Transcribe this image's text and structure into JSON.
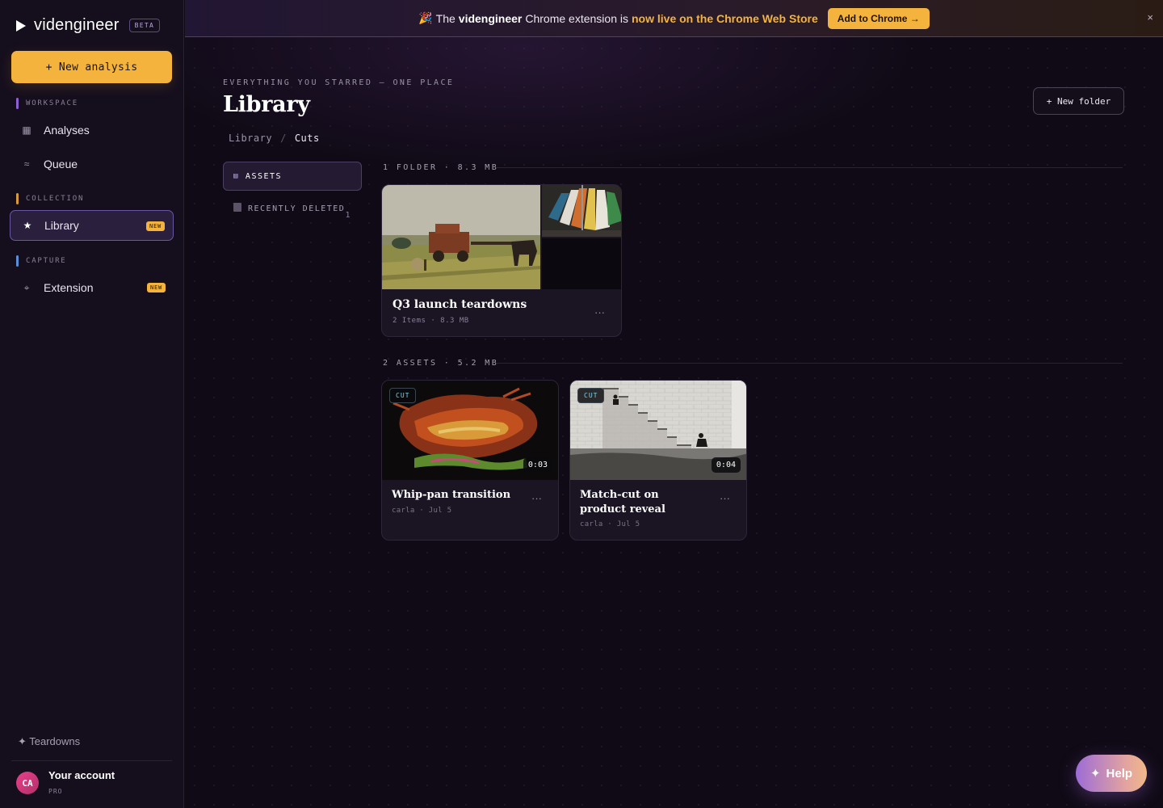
{
  "brand": {
    "name": "videngineer",
    "badge": "BETA"
  },
  "sidebar": {
    "new_analysis": "+ New analysis",
    "sections": {
      "workspace": "WORKSPACE",
      "collection": "COLLECTION",
      "capture": "CAPTURE"
    },
    "items": {
      "analyses": {
        "label": "Analyses",
        "icon": "grid-icon"
      },
      "queue": {
        "label": "Queue",
        "icon": "waves-icon"
      },
      "library": {
        "label": "Library",
        "icon": "star-icon",
        "badge": "NEW"
      },
      "extension": {
        "label": "Extension",
        "icon": "crosshair-icon",
        "badge": "NEW"
      }
    },
    "teardowns": "✦ Teardowns",
    "account": {
      "initials": "CA",
      "name": "Your account",
      "plan": "PRO"
    }
  },
  "banner": {
    "emoji": "🎉",
    "text_pre": "The",
    "brand": "videngineer",
    "text_mid": "Chrome extension is",
    "highlight": "now live on the Chrome Web Store",
    "cta": "Add to Chrome →",
    "close": "×"
  },
  "page": {
    "eyebrow": "EVERYTHING YOU STARRED — ONE PLACE",
    "title": "Library",
    "new_folder": "+ New folder",
    "breadcrumb": {
      "root": "Library",
      "sep": "/",
      "current": "Cuts"
    }
  },
  "subnav": {
    "assets": {
      "label": "ASSETS",
      "icon": "list-icon"
    },
    "deleted": {
      "label": "RECENTLY DELETED",
      "icon": "trash-icon",
      "count": "1"
    }
  },
  "folders_group": {
    "heading": "1 FOLDER · 8.3 MB",
    "items": [
      {
        "title": "Q3 launch teardowns",
        "meta": "2 Items · 8.3 MB",
        "more": "···"
      }
    ]
  },
  "assets_group": {
    "heading": "2 ASSETS · 5.2 MB",
    "items": [
      {
        "tag": "CUT",
        "duration": "0:03",
        "title": "Whip-pan transition",
        "meta": "carla · Jul 5",
        "more": "···"
      },
      {
        "tag": "CUT",
        "duration": "0:04",
        "title": "Match-cut on product reveal",
        "meta": "carla · Jul 5",
        "more": "···"
      }
    ]
  },
  "help": {
    "label": "Help",
    "icon": "sparkle-icon"
  },
  "colors": {
    "accent": "#f4b33d",
    "active_border": "#6b56a2",
    "background": "#0f0a14"
  }
}
